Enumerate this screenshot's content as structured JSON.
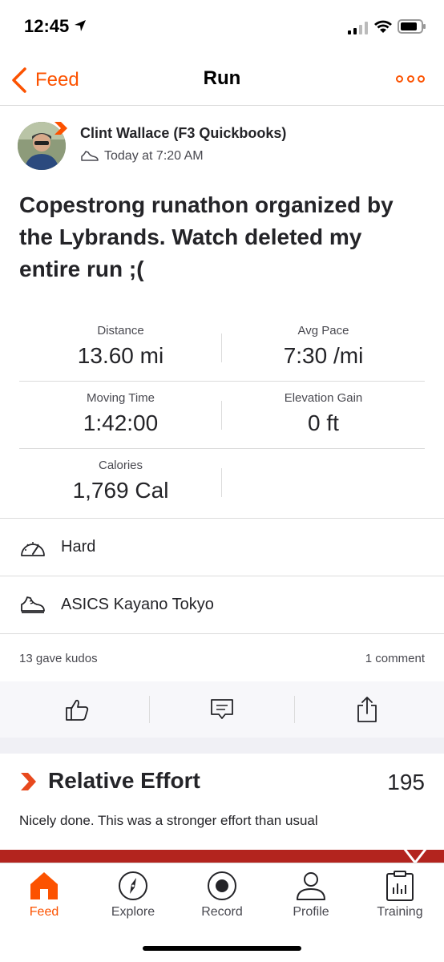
{
  "status_bar": {
    "time": "12:45"
  },
  "nav": {
    "back_label": "Feed",
    "title": "Run"
  },
  "athlete": {
    "name": "Clint Wallace (F3 Quickbooks)",
    "time": "Today at 7:20 AM"
  },
  "activity": {
    "title": "Copestrong runathon organized by the Lybrands. Watch deleted my entire run ;("
  },
  "stats": [
    {
      "left": {
        "label": "Distance",
        "value": "13.60 mi"
      },
      "right": {
        "label": "Avg Pace",
        "value": "7:30 /mi"
      }
    },
    {
      "left": {
        "label": "Moving Time",
        "value": "1:42:00"
      },
      "right": {
        "label": "Elevation Gain",
        "value": "0 ft"
      }
    },
    {
      "left": {
        "label": "Calories",
        "value": "1,769 Cal"
      },
      "right": {
        "label": "",
        "value": ""
      }
    }
  ],
  "details": {
    "perceived_exertion": "Hard",
    "gear": "ASICS Kayano Tokyo"
  },
  "social": {
    "kudos": "13 gave kudos",
    "comments": "1 comment"
  },
  "relative_effort": {
    "title": "Relative Effort",
    "score": "195",
    "description": "Nicely done. This was a stronger effort than usual"
  },
  "tabs": [
    {
      "label": "Feed",
      "icon": "home-icon",
      "active": true
    },
    {
      "label": "Explore",
      "icon": "compass-icon",
      "active": false
    },
    {
      "label": "Record",
      "icon": "record-icon",
      "active": false
    },
    {
      "label": "Profile",
      "icon": "person-icon",
      "active": false
    },
    {
      "label": "Training",
      "icon": "clipboard-chart-icon",
      "active": false
    }
  ],
  "colors": {
    "brand": "#fc5200",
    "effort_bar": "#b3241e",
    "text": "#242428",
    "muted": "#494950"
  }
}
